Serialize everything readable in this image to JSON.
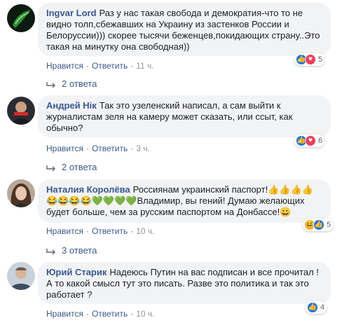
{
  "labels": {
    "like": "Нравится",
    "reply": "Ответить",
    "separator": "·"
  },
  "comments": [
    {
      "author": "Ingvar Lord",
      "text": "Раз у нас такая свобода и демократия-что то не видно толп,сбежавших на Украину из застенков России и Белоруссии))) скорее тысячи беженцев,покидающих страну..Это такая на минутку она свободная))",
      "time": "11 ч.",
      "reaction_count": "5",
      "reaction_icons": [
        "like-icon",
        "love-icon"
      ],
      "replies_label": "2 ответа"
    },
    {
      "author": "Андрей Нік",
      "text": "Так это узеленский написал, а сам выйти к журналистам зеля на камеру может сказать, или ссыт, как обычно?",
      "time": "3 ч.",
      "reaction_count": "6",
      "reaction_icons": [
        "like-icon",
        "love-icon"
      ],
      "replies_label": "2 ответа"
    },
    {
      "author": "Наталия Королёва",
      "text_a": "Россиянам украинский паспорт!",
      "emoji_a": "👍👍👍👍",
      "emoji_b": "😂😂😂😂💚💚💚💚",
      "text_b": "Владимир, вы гений! Думаю желающих будет больше, чем за русским паспортом на Донбассе!",
      "emoji_c": "😀",
      "time": "10 ч.",
      "reaction_count": "5",
      "reaction_icons": [
        "haha-icon",
        "like-icon"
      ],
      "replies_label": "3 ответа"
    },
    {
      "author": "Юрий Старик",
      "text": "Надеюсь Путин на вас подписан и все прочитал ! А то какой смысл тут это писать. Разве это политика и так это работает ?",
      "time": "10 ч.",
      "reaction_count": "4",
      "reaction_icons": [
        "like-icon"
      ]
    }
  ],
  "colors": {
    "author": "#385898",
    "bubble": "#f2f3f5",
    "like": "#1877f2",
    "love": "#f33e58",
    "haha": "#f7b125"
  }
}
